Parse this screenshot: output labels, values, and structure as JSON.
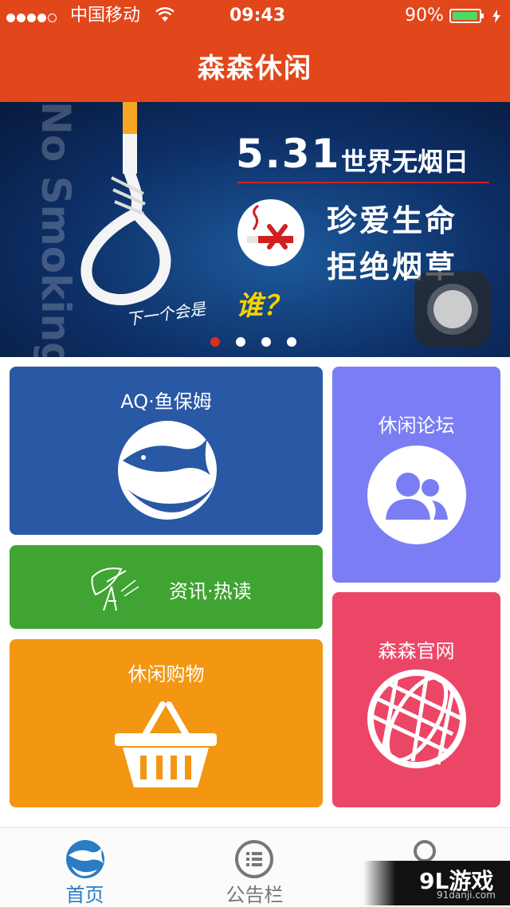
{
  "status_bar": {
    "carrier": "中国移动",
    "time": "09:43",
    "battery": "90%"
  },
  "nav": {
    "title": "森森休闲"
  },
  "banner": {
    "watermark_text": "No Smoking",
    "date": "5.31",
    "day_name": "世界无烟日",
    "slogan_line1": "珍爱生命",
    "slogan_line2": "拒绝烟草",
    "question": "下一个会是",
    "question_highlight": "谁？",
    "pages": 4,
    "active_page": 1
  },
  "tiles": {
    "aq": {
      "label": "AQ·鱼保姆",
      "icon": "fish-icon",
      "color": "#2958a4"
    },
    "forum": {
      "label": "休闲论坛",
      "icon": "users-icon",
      "color": "#7a7df3"
    },
    "news": {
      "label": "资讯·热读",
      "icon": "satellite-dish-icon",
      "color": "#3fa432"
    },
    "shop": {
      "label": "休闲购物",
      "icon": "basket-icon",
      "color": "#f39611"
    },
    "site": {
      "label": "森森官网",
      "icon": "globe-icon",
      "color": "#ec4667"
    }
  },
  "tabbar": {
    "tabs": [
      {
        "label": "首页",
        "icon": "home-fish-icon",
        "active": true
      },
      {
        "label": "公告栏",
        "icon": "list-icon",
        "active": false
      },
      {
        "label": "",
        "icon": "search-icon",
        "active": false
      }
    ]
  },
  "overlay_watermark": {
    "brand": "9L游戏",
    "url": "91danji.com"
  },
  "colors": {
    "primary": "#e2461b",
    "tab_active": "#2a7cc4"
  }
}
